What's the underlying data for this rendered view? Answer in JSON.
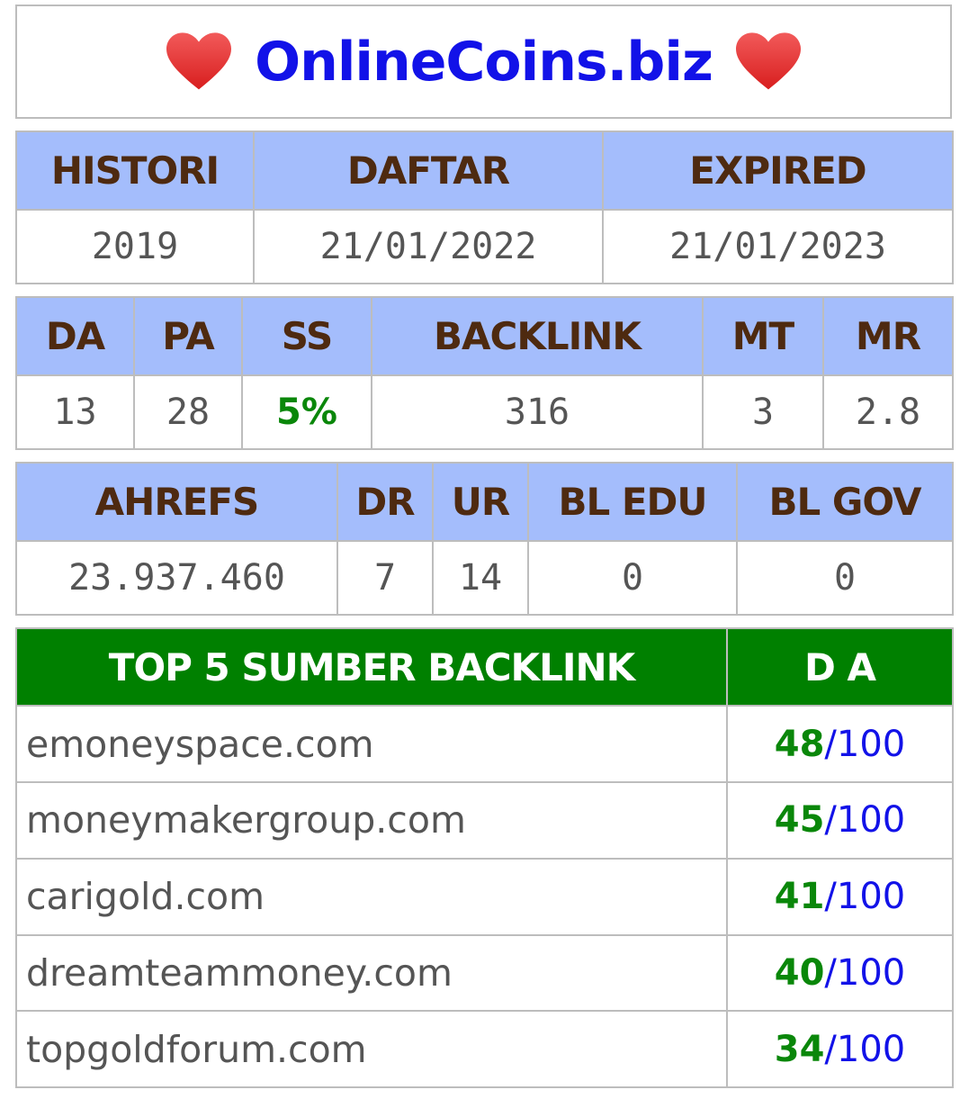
{
  "site_title": "OnlineCoins.biz",
  "colors": {
    "title": "#1212e8",
    "header_bg": "#a4bdfc",
    "header_text": "#4e2a10",
    "green_header_bg": "#008000",
    "green_value": "#0a870a",
    "heart": "#e53935"
  },
  "icons": {
    "left": "heart-icon",
    "right": "heart-icon"
  },
  "domain_info": {
    "headers": [
      "HISTORI",
      "DAFTAR",
      "EXPIRED"
    ],
    "values": [
      "2019",
      "21/01/2022",
      "21/01/2023"
    ]
  },
  "moz": {
    "headers": [
      "DA",
      "PA",
      "SS",
      "BACKLINK",
      "MT",
      "MR"
    ],
    "values": [
      "13",
      "28",
      "5%",
      "316",
      "3",
      "2.8"
    ]
  },
  "ahrefs": {
    "headers": [
      "AHREFS",
      "DR",
      "UR",
      "BL EDU",
      "BL GOV"
    ],
    "values": [
      "23.937.460",
      "7",
      "14",
      "0",
      "0"
    ]
  },
  "backlinks": {
    "header_source": "TOP 5 SUMBER BACKLINK",
    "header_da": "D A",
    "separator": "/",
    "max": "100",
    "rows": [
      {
        "site": "emoneyspace.com",
        "da": "48"
      },
      {
        "site": "moneymakergroup.com",
        "da": "45"
      },
      {
        "site": "carigold.com",
        "da": "41"
      },
      {
        "site": "dreamteammoney.com",
        "da": "40"
      },
      {
        "site": "topgoldforum.com",
        "da": "34"
      }
    ]
  }
}
